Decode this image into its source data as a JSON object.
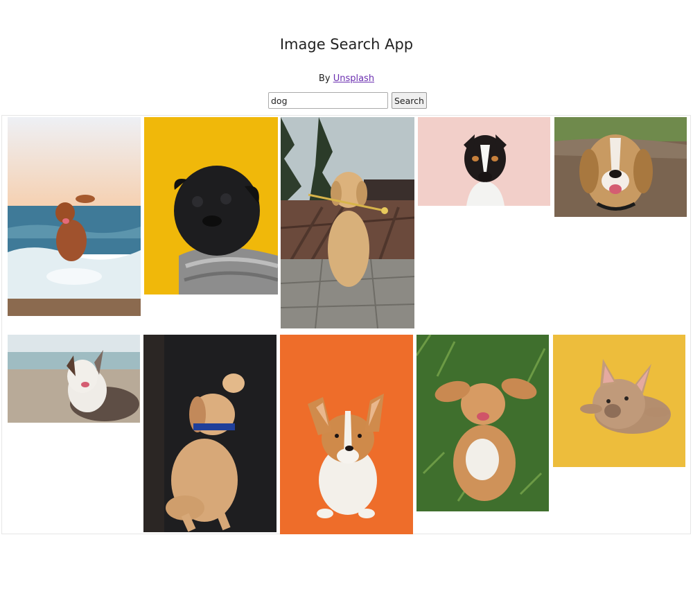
{
  "app": {
    "title": "Image Search App",
    "byline_prefix": "By",
    "byline_link": "Unsplash"
  },
  "search": {
    "value": "dog",
    "button_label": "Search"
  },
  "colors": {
    "link": "#6b2fb0",
    "pug_background": "#f0b80a",
    "corgi_background": "#ee6d2a",
    "frenchie_background": "#edbd3c",
    "beach_sky": "#f7d9bd",
    "pink_background": "#f2cfc9"
  },
  "results": [
    {
      "subject": "brown dog running on beach waves"
    },
    {
      "subject": "black pug in knit sweater on yellow"
    },
    {
      "subject": "golden retriever puppy holding flower"
    },
    {
      "subject": "tricolor terrier on pink background"
    },
    {
      "subject": "smiling beagle on dirt path"
    },
    {
      "subject": "australian shepherd lying on beach"
    },
    {
      "subject": "labrador puppy with blue collar"
    },
    {
      "subject": "corgi puppy on orange background"
    },
    {
      "subject": "spaniel puppy lying in grass"
    },
    {
      "subject": "french bulldog lying on yellow"
    }
  ]
}
